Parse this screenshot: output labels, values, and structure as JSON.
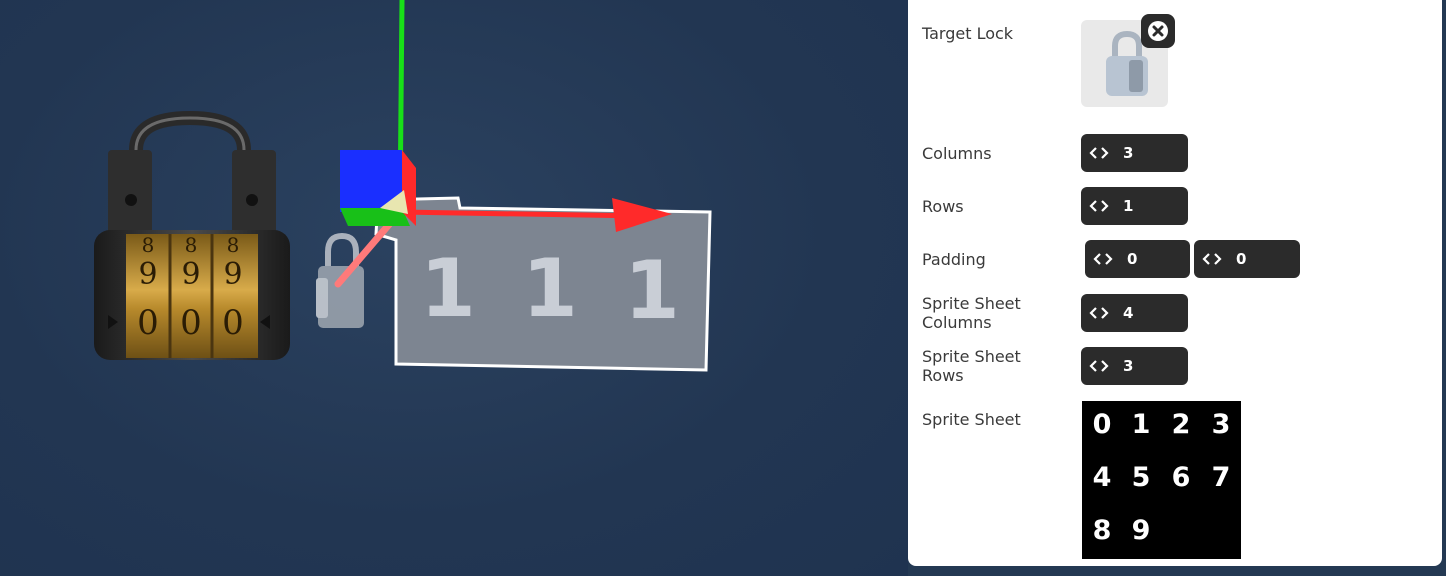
{
  "viewport": {
    "lock_dials": {
      "top_row": [
        "8",
        "8",
        "8"
      ],
      "middle_row": [
        "9",
        "9",
        "9"
      ],
      "bottom_row": [
        "0",
        "0",
        "0"
      ]
    },
    "display_digits": [
      "1",
      "1",
      "1"
    ],
    "gizmo_colors": {
      "x": "#ff2a2a",
      "y": "#18e018",
      "z": "#1a2fff"
    }
  },
  "panel": {
    "target_lock": {
      "label": "Target Lock",
      "icon": "padlock-icon"
    },
    "columns": {
      "label": "Columns",
      "value": "3"
    },
    "rows": {
      "label": "Rows",
      "value": "1"
    },
    "padding": {
      "label": "Padding",
      "x": "0",
      "y": "0"
    },
    "sprite_sheet_columns": {
      "label": "Sprite Sheet Columns",
      "value": "4"
    },
    "sprite_sheet_rows": {
      "label": "Sprite Sheet Rows",
      "value": "3"
    },
    "sprite_sheet": {
      "label": "Sprite Sheet",
      "digits": [
        "0",
        "1",
        "2",
        "3",
        "4",
        "5",
        "6",
        "7",
        "8",
        "9"
      ]
    }
  }
}
